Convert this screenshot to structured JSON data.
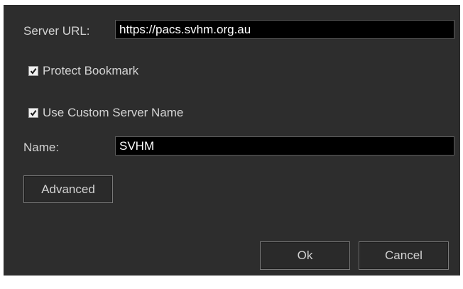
{
  "server": {
    "label": "Server URL:",
    "value": "https://pacs.svhm.org.au"
  },
  "protect_bookmark": {
    "label": "Protect Bookmark",
    "checked": true
  },
  "custom_server_name": {
    "label": "Use Custom Server Name",
    "checked": true
  },
  "name": {
    "label": "Name:",
    "value": "SVHM"
  },
  "buttons": {
    "advanced": "Advanced",
    "ok": "Ok",
    "cancel": "Cancel"
  },
  "icons": {
    "checkmark": "checkmark-icon"
  },
  "colors": {
    "background": "#2d2d2d",
    "field_background": "#000000",
    "text": "#d2d2d2",
    "checkbox_fill": "#f0f0f0"
  }
}
